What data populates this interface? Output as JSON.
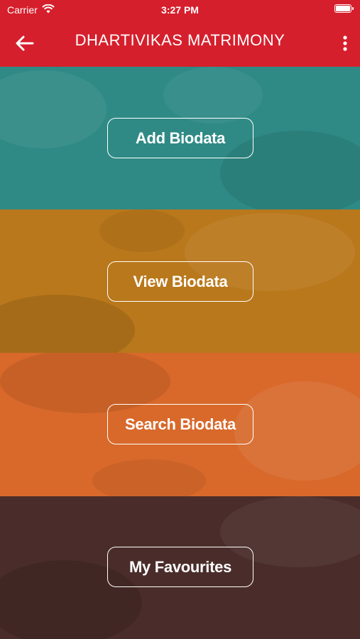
{
  "status_bar": {
    "carrier": "Carrier",
    "time": "3:27 PM"
  },
  "nav": {
    "title": "DHARTIVIKAS MATRIMONY",
    "back_icon": "arrow-left-icon",
    "menu_icon": "more-vertical-icon"
  },
  "menu": {
    "add_label": "Add Biodata",
    "view_label": "View Biodata",
    "search_label": "Search Biodata",
    "favourites_label": "My Favourites"
  },
  "colors": {
    "header": "#d61f2c",
    "teal": "#2f8a85",
    "amber": "#b9781b",
    "orange": "#d8692b",
    "brown": "#4a2d2a"
  }
}
